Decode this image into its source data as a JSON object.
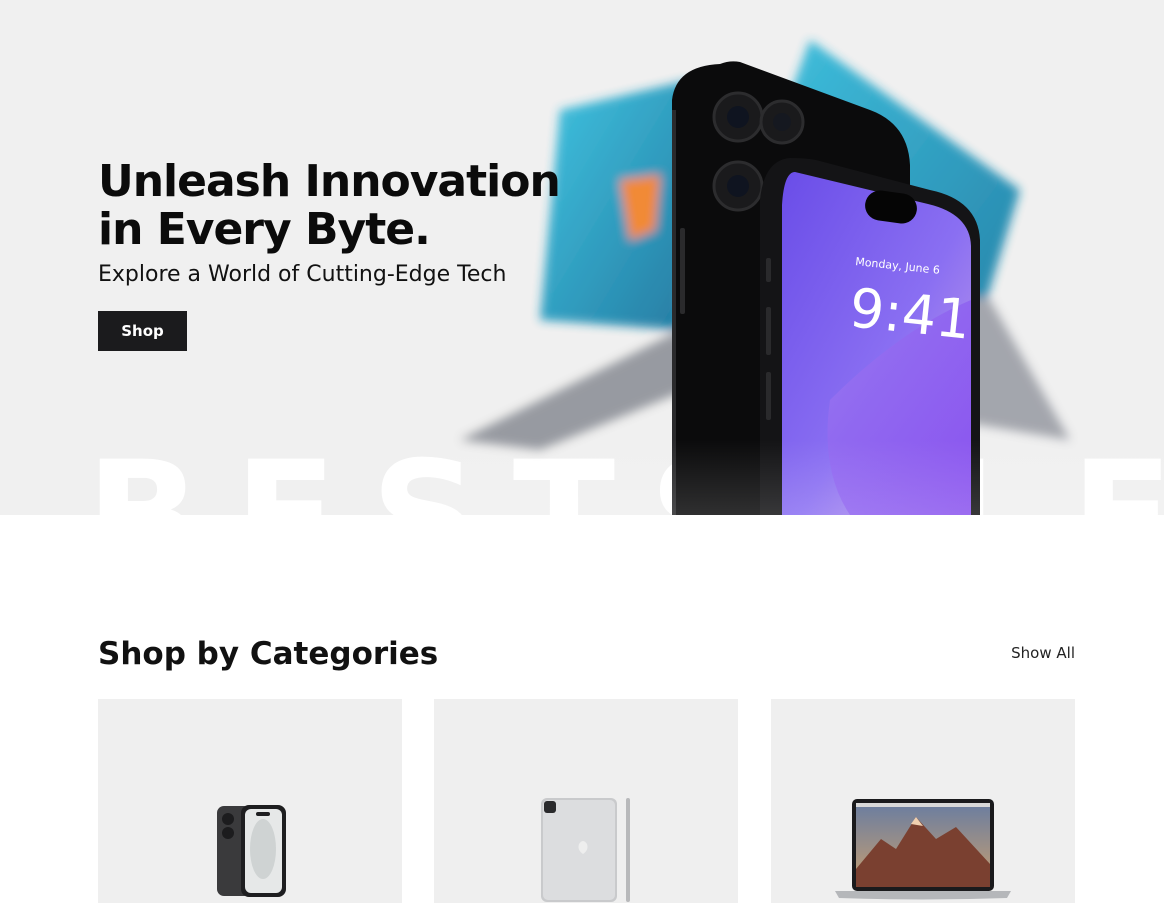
{
  "hero": {
    "title_line1": "Unleash Innovation",
    "title_line2": "in Every Byte.",
    "subtitle": "Explore a World of Cutting-Edge Tech",
    "cta_label": "Shop",
    "background_word": "BESTSALE",
    "phone_date": "Monday, June 6",
    "phone_time": "9:41",
    "colors": {
      "background": "#f0f0f0",
      "button": "#1b1b1d",
      "screen": "#7b5cf0"
    }
  },
  "categories": {
    "title": "Shop by Categories",
    "show_all_label": "Show All",
    "items": [
      {
        "icon": "smartphone-icon"
      },
      {
        "icon": "tablet-icon"
      },
      {
        "icon": "laptop-icon"
      }
    ]
  }
}
